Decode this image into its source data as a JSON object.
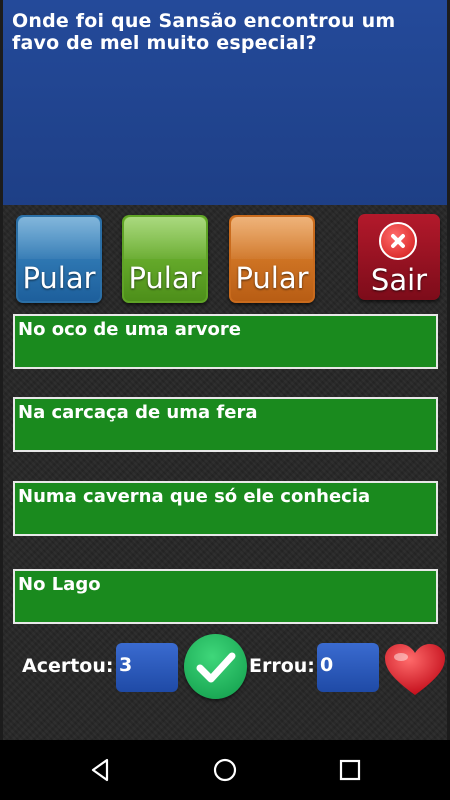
{
  "question": {
    "text": "Onde foi que Sansão encontrou um favo de mel muito especial?"
  },
  "controls": {
    "skip_blue_label": "Pular",
    "skip_green_label": "Pular",
    "skip_orange_label": "Pular",
    "exit_label": "Sair"
  },
  "answers": [
    {
      "text": "No oco de uma arvore"
    },
    {
      "text": "Na carcaça de uma fera"
    },
    {
      "text": "Numa caverna que só ele conhecia"
    },
    {
      "text": "No Lago"
    }
  ],
  "score": {
    "correct_label": "Acertou:",
    "correct_value": "3",
    "wrong_label": "Errou:",
    "wrong_value": "0"
  },
  "colors": {
    "question_bg": "#244a9a",
    "answer_bg": "#1a8a1e",
    "exit_bg": "#b3192b"
  },
  "icons": {
    "correct": "check-icon",
    "lives": "heart-icon",
    "nav_back": "back-icon",
    "nav_home": "home-icon",
    "nav_recent": "recent-apps-icon"
  }
}
